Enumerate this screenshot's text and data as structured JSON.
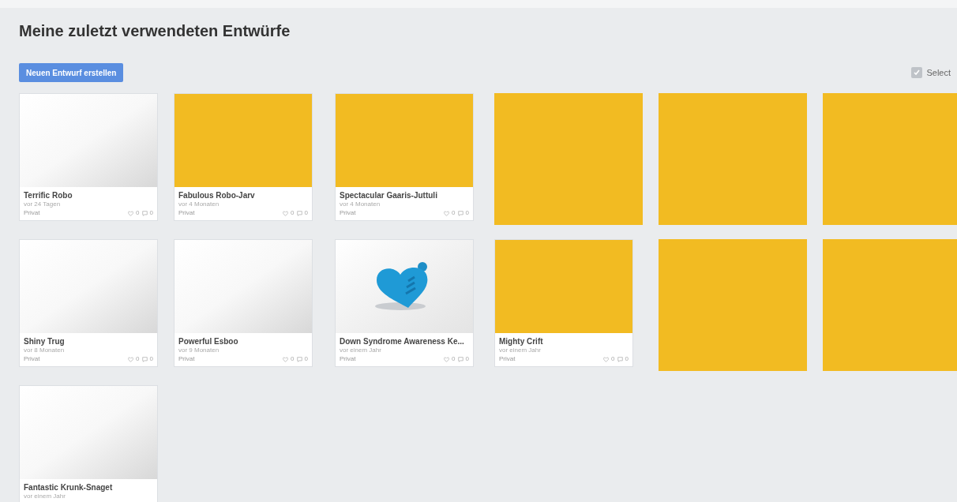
{
  "title": "Meine zuletzt verwendeten Entwürfe",
  "new_button": "Neuen Entwurf erstellen",
  "select": {
    "label": "Select",
    "checked": true
  },
  "cards": [
    {
      "kind": "design",
      "thumbnail": {
        "kind": "blank"
      },
      "name": "Terrific Robo",
      "age": "vor 24 Tagen",
      "visibility": "Privat",
      "likes": "0",
      "comments": "0"
    },
    {
      "kind": "design",
      "thumbnail": {
        "kind": "yellow"
      },
      "name": "Fabulous Robo-Jarv",
      "age": "vor 4 Monaten",
      "visibility": "Privat",
      "likes": "0",
      "comments": "0"
    },
    {
      "kind": "design",
      "thumbnail": {
        "kind": "yellow"
      },
      "name": "Spectacular Gaaris-Juttuli",
      "age": "vor 4 Monaten",
      "visibility": "Privat",
      "likes": "0",
      "comments": "0"
    },
    {
      "kind": "placeholder"
    },
    {
      "kind": "placeholder"
    },
    {
      "kind": "placeholder"
    },
    {
      "kind": "design",
      "thumbnail": {
        "kind": "blank"
      },
      "name": "Shiny Trug",
      "age": "vor 8 Monaten",
      "visibility": "Privat",
      "likes": "0",
      "comments": "0"
    },
    {
      "kind": "design",
      "thumbnail": {
        "kind": "blank"
      },
      "name": "Powerful Esboo",
      "age": "vor 9 Monaten",
      "visibility": "Privat",
      "likes": "0",
      "comments": "0"
    },
    {
      "kind": "design",
      "thumbnail": {
        "kind": "heart"
      },
      "name": "Down Syndrome Awareness Ke...",
      "age": "vor einem Jahr",
      "visibility": "Privat",
      "likes": "0",
      "comments": "0"
    },
    {
      "kind": "design",
      "thumbnail": {
        "kind": "yellow"
      },
      "name": "Mighty Crift",
      "age": "vor einem Jahr",
      "visibility": "Privat",
      "likes": "0",
      "comments": "0"
    },
    {
      "kind": "placeholder"
    },
    {
      "kind": "placeholder"
    },
    {
      "kind": "design",
      "thumbnail": {
        "kind": "blank"
      },
      "name": "Fantastic Krunk-Snaget",
      "age": "vor einem Jahr"
    }
  ]
}
